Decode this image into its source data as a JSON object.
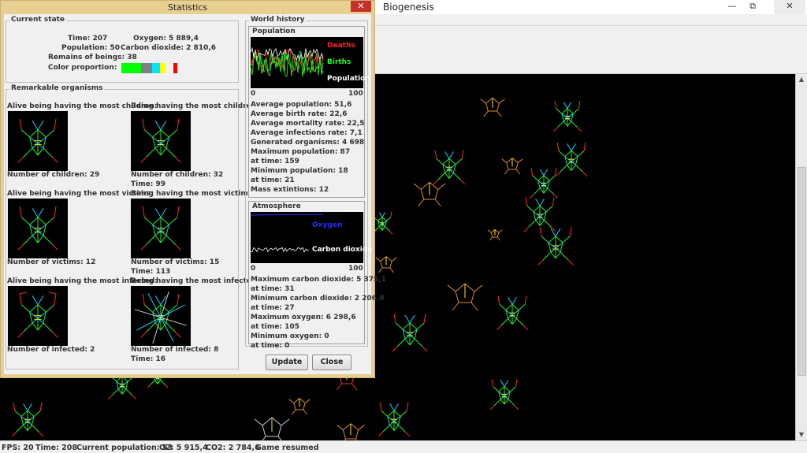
{
  "main_window": {
    "title": "Biogenesis",
    "controls": {
      "minimize": "—",
      "restore": "⧉",
      "close": "✕"
    }
  },
  "status_bar": {
    "fps": "FPS: 20",
    "time": "Time: 208",
    "population": "Current population: 53",
    "o2": "O2: 5 915,4",
    "co2": "CO2: 2 784,6",
    "message": "Game resumed"
  },
  "stats": {
    "title": "Statistics",
    "close_label": "✕",
    "current_state": {
      "title": "Current state",
      "time": "Time: 207",
      "oxygen": "Oxygen: 5 889,4",
      "population": "Population: 50",
      "co2": "Carbon dioxide: 2 810,6",
      "remains": "Remains of beings: 38",
      "color_label": "Color proportion:",
      "color_segments": [
        {
          "color": "#00ff00",
          "fraction": 0.33
        },
        {
          "color": "#808080",
          "fraction": 0.18
        },
        {
          "color": "#00e5ff",
          "fraction": 0.13
        },
        {
          "color": "#ffff00",
          "fraction": 0.1
        },
        {
          "color": "#f0f0f0",
          "fraction": 0.13
        },
        {
          "color": "#ff0000",
          "fraction": 0.07
        }
      ]
    },
    "remarkable": {
      "title": "Remarkable organisms",
      "alive_most_children": "Alive being having the most children:",
      "most_children": "Being having the most children:",
      "alive_children_count": "Number of children: 29",
      "children_count": "Number of children: 32",
      "children_time": "Time: 99",
      "alive_most_victims": "Alive being having the most victims:",
      "most_victims": "Being having the most victims:",
      "alive_victims_count": "Number of victims: 12",
      "victims_count": "Number of victims: 15",
      "victims_time": "Time: 113",
      "alive_most_infected": "Alive being having the most infected:",
      "most_infected": "Being having the most infected:",
      "alive_infected_count": "Number of infected: 2",
      "infected_count": "Number of infected: 8",
      "infected_time": "Time: 16"
    },
    "world_history": {
      "title": "World history",
      "population": {
        "title": "Population",
        "legend_deaths": "Deaths",
        "legend_births": "Births",
        "legend_population": "Population",
        "axis_min": "0",
        "axis_max": "100",
        "avg_population": "Average population: 51,6",
        "avg_birth": "Average birth rate: 22,6",
        "avg_mortality": "Average mortality rate: 22,5",
        "avg_infections": "Average infections rate: 7,1",
        "generated": "Generated organisms: 4 698",
        "max_population": "Maximum population: 87",
        "max_pop_time": "at time: 159",
        "min_population": "Minimum population: 18",
        "min_pop_time": "at time: 21",
        "extinctions": "Mass extintions: 12"
      },
      "atmosphere": {
        "title": "Atmosphere",
        "legend_oxygen": "Oxygen",
        "legend_co2": "Carbon dioxide",
        "axis_min": "0",
        "axis_max": "100",
        "max_co2": "Maximum carbon dioxide: 5 375,1",
        "max_co2_time": "at time: 31",
        "min_co2": "Minimum carbon dioxide: 2 206,8",
        "min_co2_time": "at time: 27",
        "max_o2": "Maximum oxygen: 6 298,6",
        "max_o2_time": "at time: 105",
        "min_o2": "Minimum oxygen: 0",
        "min_o2_time": "at time: 0"
      }
    },
    "buttons": {
      "update": "Update",
      "close": "Close"
    }
  }
}
